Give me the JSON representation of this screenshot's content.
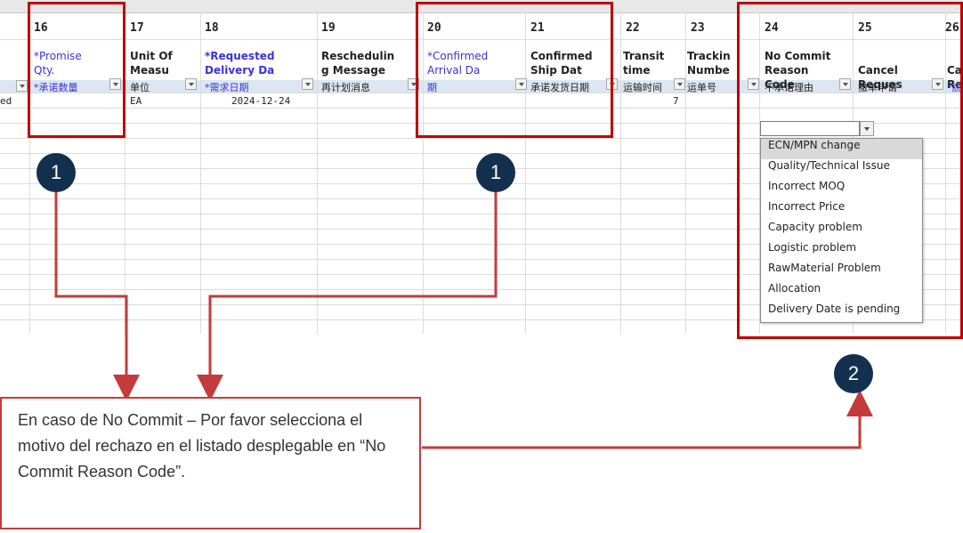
{
  "sheet": {
    "column_numbers": [
      "16",
      "17",
      "18",
      "19",
      "20",
      "21",
      "22",
      "23",
      "24",
      "25",
      "26"
    ],
    "headers": {
      "partial_left": "",
      "promise_qty": "*Promise\nQty.",
      "unit_of_measure": "Unit Of\nMeasu",
      "requested_delivery": "*Requested\nDelivery Da",
      "rescheduling": "Reschedulin\ng Message",
      "confirmed_arrival": "*Confirmed\nArrival Da",
      "confirmed_ship": "Confirmed\nShip Dat",
      "transit_time": "Transit\ntime",
      "tracking_number": "Trackin\nNumbe",
      "no_commit_reason": "No Commit\nReason\nCode",
      "cancel_request": "Cancel\nReques",
      "partial_right": "Ca\nRe"
    },
    "cn_labels": {
      "promise_qty": "*承诺数量",
      "unit_of_measure": "单位",
      "requested_delivery": "*需求日期",
      "rescheduling": "再计划消息",
      "confirmed_arrival": "期",
      "confirmed_ship": "承诺发货日期",
      "transit_time": "运输时间",
      "tracking_number": "运单号",
      "no_commit_reason": "不承诺理由",
      "cancel_request": "撤单申请",
      "partial_right": "*説"
    },
    "row1": {
      "left_partial": "ed",
      "unit": "EA",
      "requested_date": "2024-12-24",
      "transit": "7"
    }
  },
  "dropdown": {
    "options": [
      "ECN/MPN change",
      "Quality/Technical Issue",
      "Incorrect MOQ",
      "Incorrect Price",
      "Capacity problem",
      "Logistic problem",
      "RawMaterial Problem",
      "Allocation",
      "Delivery Date is pending"
    ],
    "selected_index": 0
  },
  "markers": {
    "marker1_a": "1",
    "marker1_b": "1",
    "marker2": "2"
  },
  "note": {
    "text": "En caso de No Commit – Por favor selecciona el motivo del rechazo en el listado desplegable en “No Commit Reason Code”."
  },
  "colors": {
    "accent_red": "#c00000",
    "marker_navy": "#14304f",
    "required_blue": "#3a33d6"
  }
}
